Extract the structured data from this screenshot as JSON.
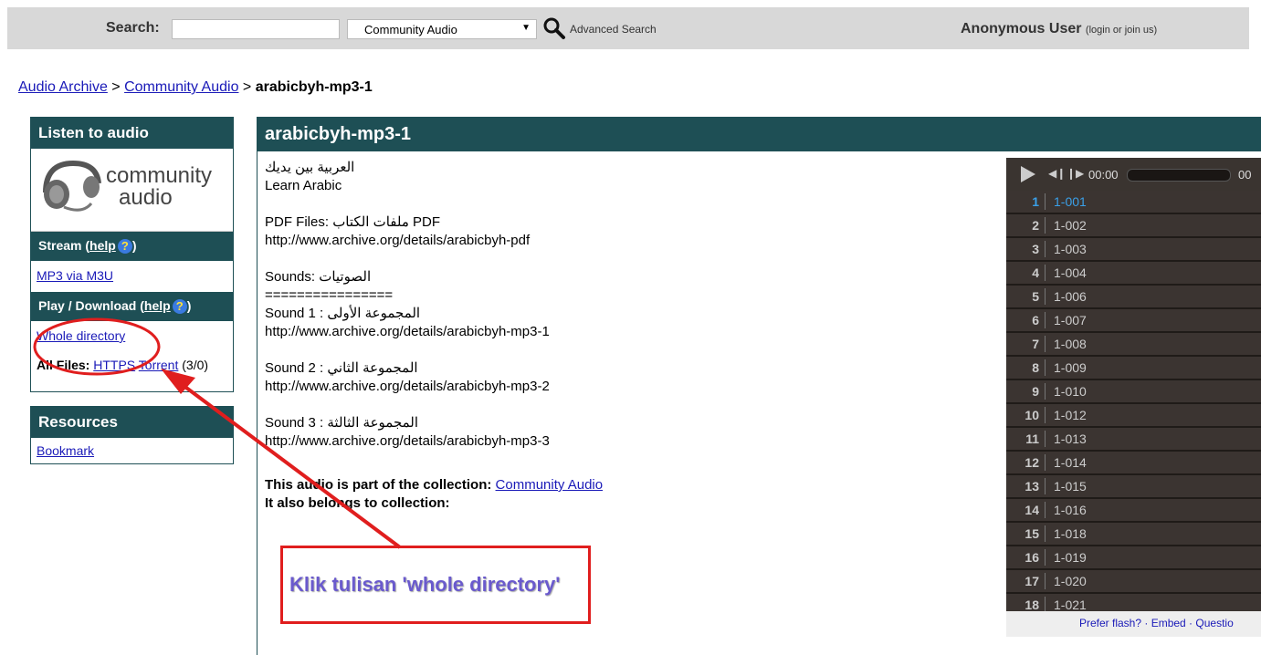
{
  "topbar": {
    "search_label": "Search:",
    "search_value": "",
    "search_select": "Community Audio",
    "advanced_search": "Advanced Search",
    "user_name": "Anonymous User",
    "user_links": "(login or join us)"
  },
  "breadcrumb": {
    "link1": "Audio Archive",
    "sep1": " > ",
    "link2": "Community Audio",
    "sep2": " > ",
    "current": "arabicbyh-mp3-1"
  },
  "sidebar": {
    "listen_title": "Listen to audio",
    "logo_line1": "community",
    "logo_line2": "audio",
    "stream_label": "Stream",
    "help_label": "help",
    "mp3_m3u": "MP3 via M3U",
    "play_download": "Play / Download",
    "whole_directory": "Whole directory",
    "all_files_label": "All Files:",
    "https": "HTTPS",
    "torrent": "Torrent",
    "count": "(3/0)",
    "resources_title": "Resources",
    "bookmark": "Bookmark"
  },
  "main": {
    "title": "arabicbyh-mp3-1",
    "desc": {
      "l1": "العربية بين يديك",
      "l2": "Learn Arabic",
      "l3": "PDF Files: ملفات الكتاب PDF",
      "l4": "http://www.archive.org/details/arabicbyh-pdf",
      "l5": "Sounds: الصوتيات",
      "l6": "================",
      "l7": "Sound 1 : المجموعة الأولى",
      "l8": "http://www.archive.org/details/arabicbyh-mp3-1",
      "l9": "Sound 2 : المجموعة الثاني",
      "l10": "http://www.archive.org/details/arabicbyh-mp3-2",
      "l11": "Sound 3 : المجموعة الثالثة",
      "l12": "http://www.archive.org/details/arabicbyh-mp3-3"
    },
    "collection_prefix": "This audio is part of the collection: ",
    "collection_link": "Community Audio",
    "also_belongs": "It also belongs to collection:"
  },
  "player": {
    "time": "00:00",
    "time_end": "00",
    "tracks": [
      {
        "num": "1",
        "name": "1-001"
      },
      {
        "num": "2",
        "name": "1-002"
      },
      {
        "num": "3",
        "name": "1-003"
      },
      {
        "num": "4",
        "name": "1-004"
      },
      {
        "num": "5",
        "name": "1-006"
      },
      {
        "num": "6",
        "name": "1-007"
      },
      {
        "num": "7",
        "name": "1-008"
      },
      {
        "num": "8",
        "name": "1-009"
      },
      {
        "num": "9",
        "name": "1-010"
      },
      {
        "num": "10",
        "name": "1-012"
      },
      {
        "num": "11",
        "name": "1-013"
      },
      {
        "num": "12",
        "name": "1-014"
      },
      {
        "num": "13",
        "name": "1-015"
      },
      {
        "num": "14",
        "name": "1-016"
      },
      {
        "num": "15",
        "name": "1-018"
      },
      {
        "num": "16",
        "name": "1-019"
      },
      {
        "num": "17",
        "name": "1-020"
      },
      {
        "num": "18",
        "name": "1-021"
      }
    ],
    "footer": "Prefer flash? · Embed · Questio"
  },
  "annotation": {
    "text": "Klik tulisan 'whole directory'"
  },
  "colors": {
    "header_teal": "#1e4f55",
    "annotation_red": "#e01e1e",
    "annotation_text": "#6a5acd"
  }
}
